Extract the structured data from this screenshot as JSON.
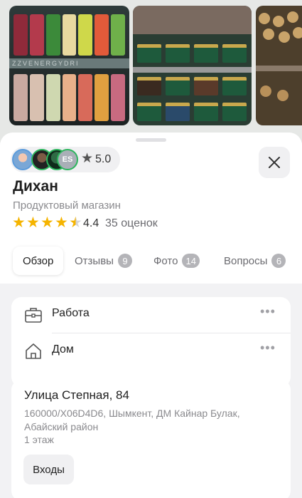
{
  "chip": {
    "avatar_initials": "ES",
    "score": "5.0"
  },
  "place": {
    "name": "Дихан",
    "category": "Продуктовый магазин",
    "rating": "4.4",
    "reviews_count": "35 оценок"
  },
  "tabs": [
    {
      "label": "Обзор"
    },
    {
      "label": "Отзывы",
      "badge": "9"
    },
    {
      "label": "Фото",
      "badge": "14"
    },
    {
      "label": "Вопросы",
      "badge": "6"
    }
  ],
  "saved": [
    {
      "label": "Работа",
      "icon": "briefcase-icon"
    },
    {
      "label": "Дом",
      "icon": "home-icon"
    }
  ],
  "address": {
    "line1": "Улица Степная, 84",
    "line2": "160000/X06D4D6, Шымкент, ДМ Кайнар Булак, Абайский район",
    "floor": "1 этаж",
    "entrances_label": "Входы"
  },
  "photos": {
    "can_banner": "ZZVENERGYDRI"
  },
  "colors": {
    "star": "#f5b400",
    "avatar_ring": "#2db55d",
    "badge": "#b4b4b8"
  }
}
